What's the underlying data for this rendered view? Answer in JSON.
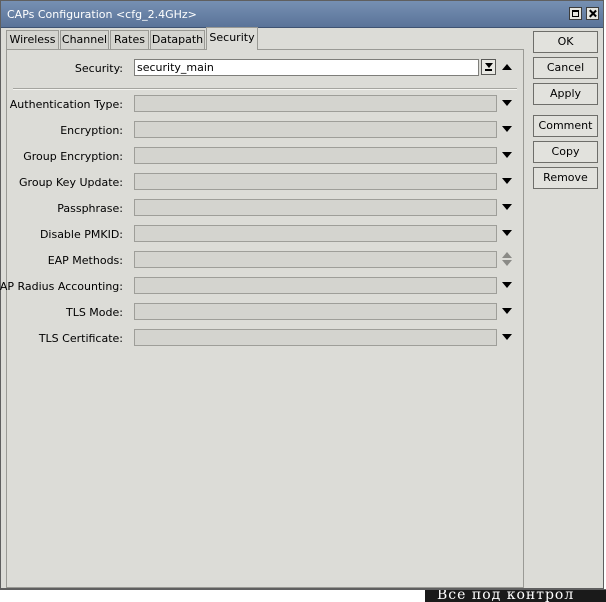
{
  "window": {
    "title": "CAPs Configuration <cfg_2.4GHz>"
  },
  "tabs": [
    {
      "label": "Wireless",
      "active": false
    },
    {
      "label": "Channel",
      "active": false
    },
    {
      "label": "Rates",
      "active": false
    },
    {
      "label": "Datapath",
      "active": false
    },
    {
      "label": "Security",
      "active": true
    }
  ],
  "security": {
    "label": "Security:",
    "value": "security_main"
  },
  "fields": [
    {
      "label": "Authentication Type:",
      "value": ""
    },
    {
      "label": "Encryption:",
      "value": ""
    },
    {
      "label": "Group Encryption:",
      "value": ""
    },
    {
      "label": "Group Key Update:",
      "value": ""
    },
    {
      "label": "Passphrase:",
      "value": ""
    },
    {
      "label": "Disable PMKID:",
      "value": ""
    },
    {
      "label": "EAP Methods:",
      "value": ""
    },
    {
      "label": "EAP Radius Accounting:",
      "value": ""
    },
    {
      "label": "TLS Mode:",
      "value": ""
    },
    {
      "label": "TLS Certificate:",
      "value": ""
    }
  ],
  "buttons": {
    "ok": "OK",
    "cancel": "Cancel",
    "apply": "Apply",
    "comment": "Comment",
    "copy": "Copy",
    "remove": "Remove"
  },
  "background": {
    "text": "Все под контрол"
  },
  "icons": {
    "maximize": "maximize-icon",
    "close": "close-icon",
    "dropdown": "triangle-down-icon",
    "collapse": "triangle-up-icon",
    "combo": "combo-dropdown-icon"
  }
}
